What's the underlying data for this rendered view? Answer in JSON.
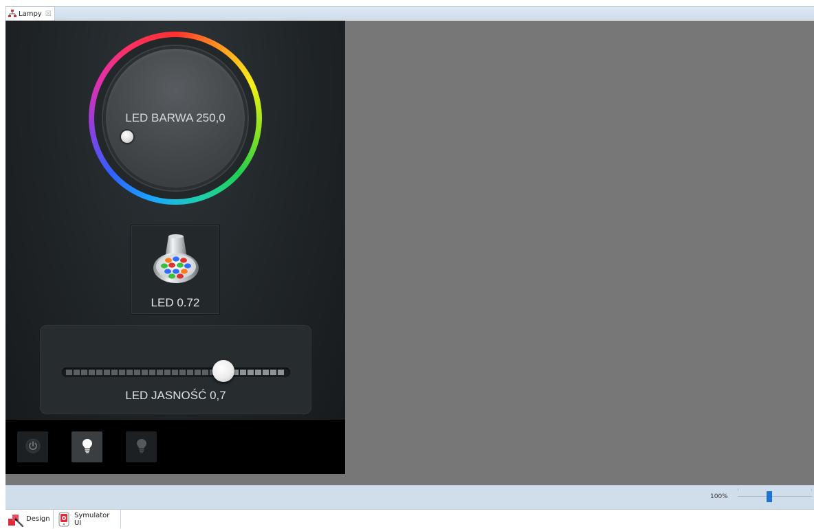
{
  "editor_tab": {
    "label": "Lampy",
    "close": "☒"
  },
  "device": {
    "color_wheel": {
      "label": "LED BARWA 250,0",
      "hue_value": 250.0
    },
    "led_tile": {
      "label": "LED 0.72",
      "level": 0.72
    },
    "brightness": {
      "label": "LED JASNOŚĆ 0,7",
      "level": 0.7
    },
    "buttons": [
      {
        "name": "power",
        "icon": "power-icon"
      },
      {
        "name": "bulb-on",
        "icon": "lightbulb-icon"
      },
      {
        "name": "bulb-off",
        "icon": "lightbulb-off-icon"
      }
    ]
  },
  "zoom": {
    "value": "100%",
    "level": 1.0
  },
  "bottom_tabs": [
    {
      "label": "Design",
      "icon": "design-icon"
    },
    {
      "label": "Symulator UI",
      "icon": "simulator-icon"
    }
  ],
  "colors": {
    "workspace": "#777777",
    "device_bg": "#1f2427",
    "accent": "#1d74d4"
  }
}
